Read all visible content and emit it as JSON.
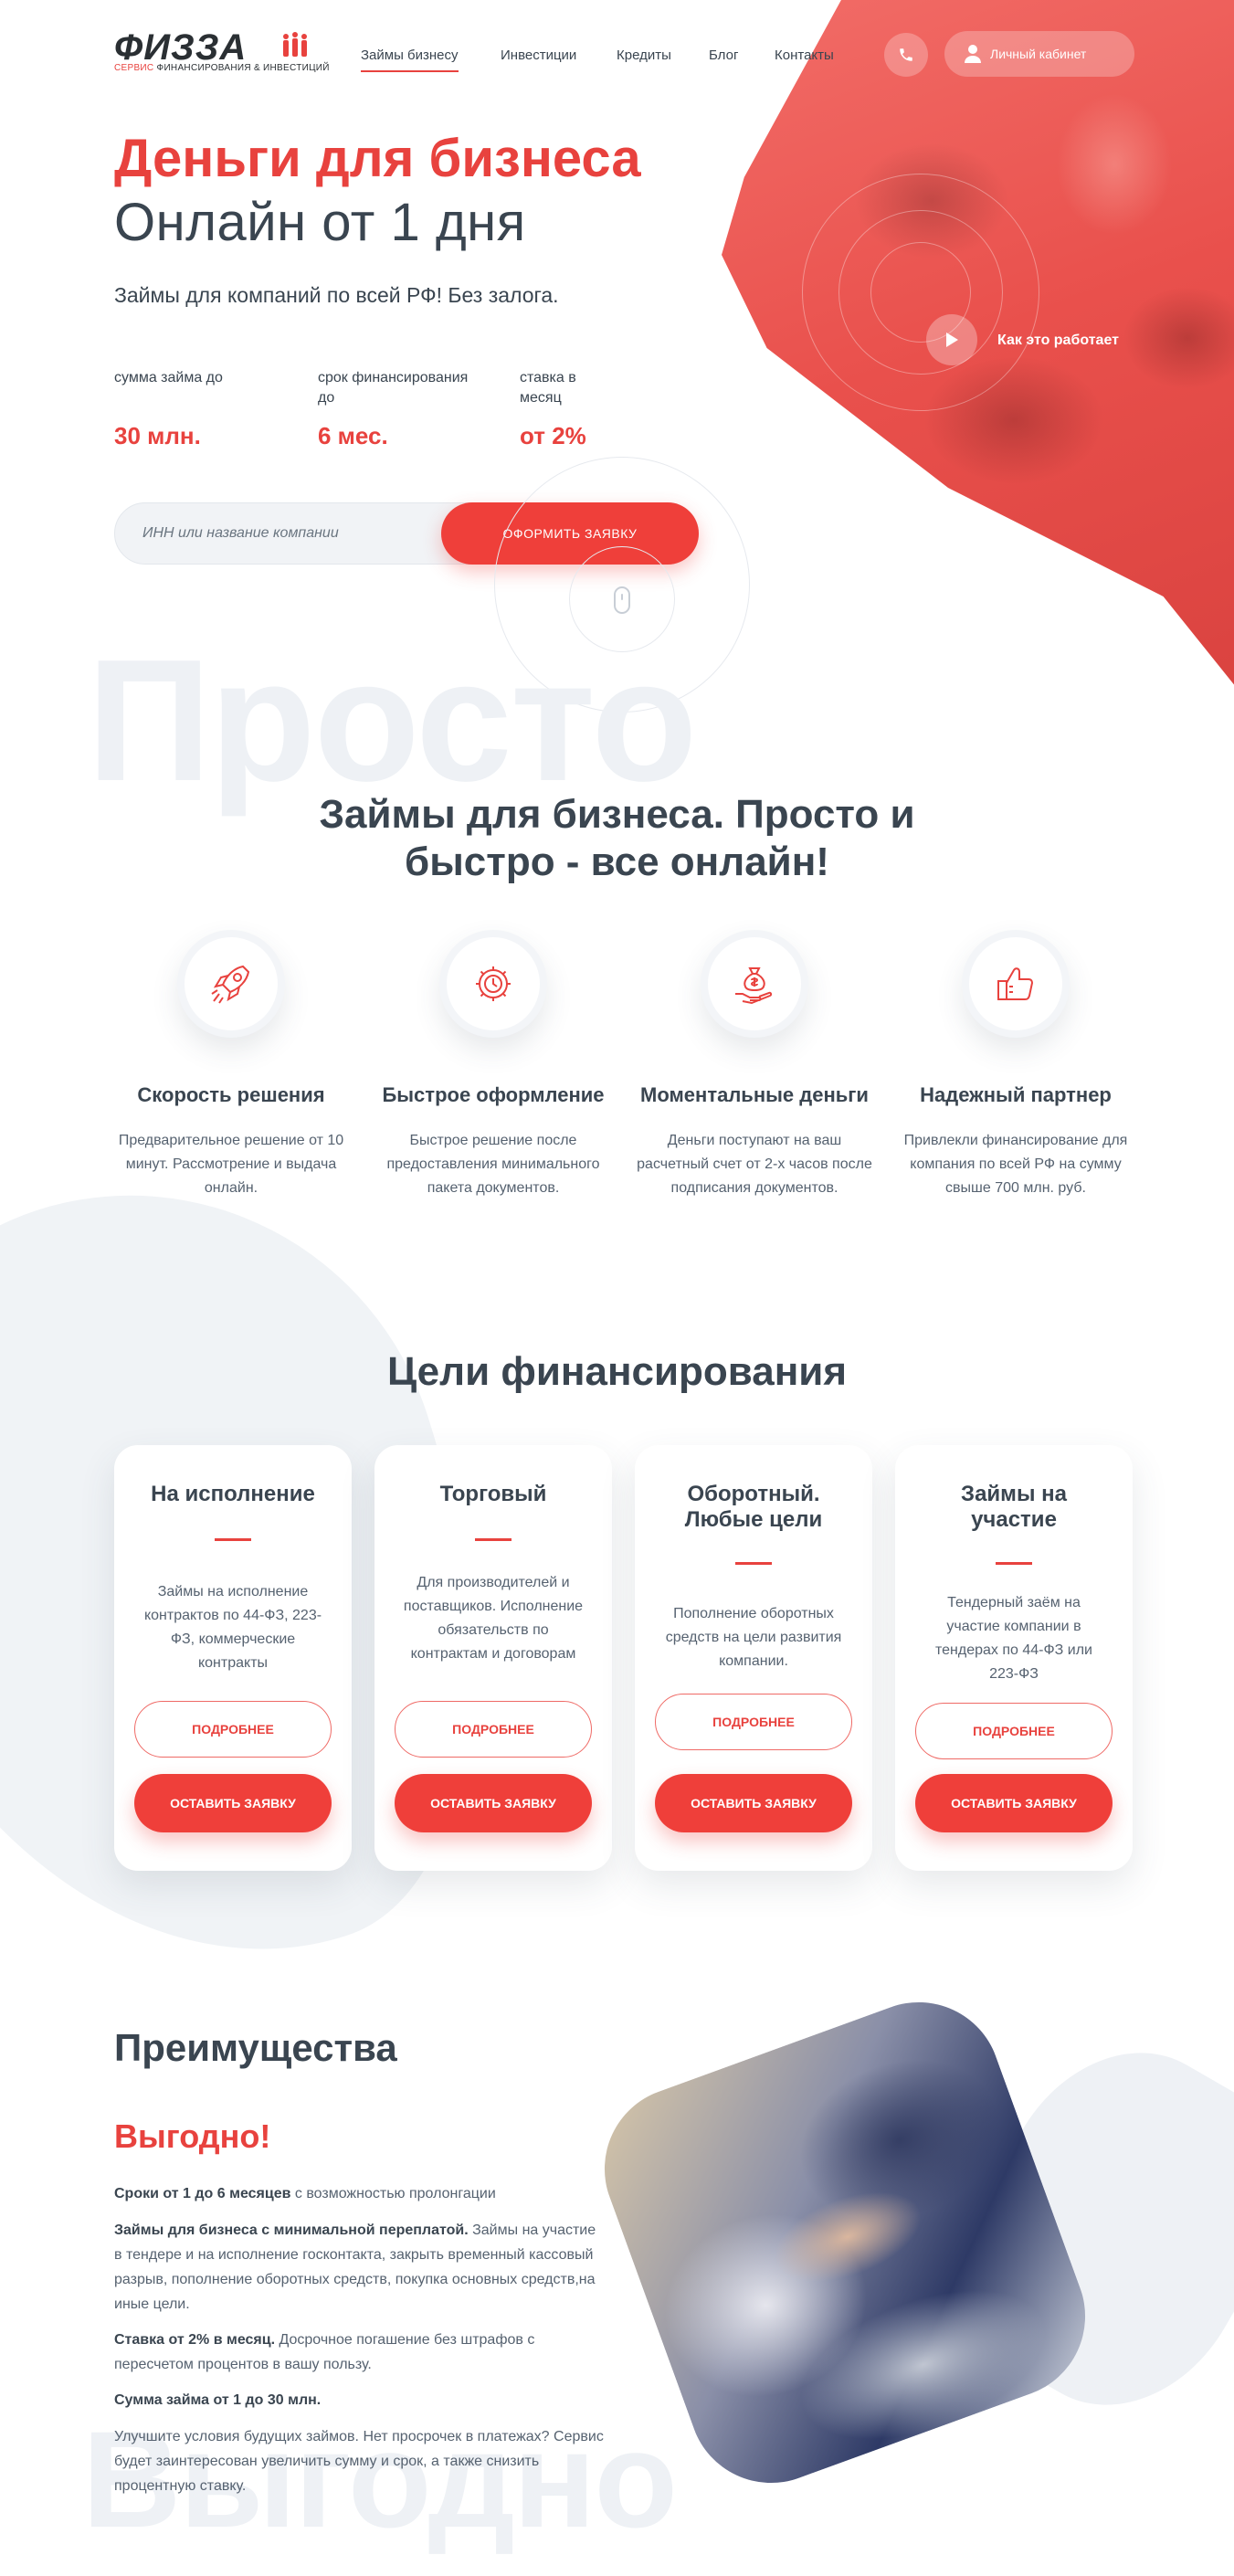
{
  "brand": {
    "logo": "ФИЗЗА",
    "tagline_red": "СЕРВИС",
    "tagline_rest": "ФИНАНСИРОВАНИЯ & ИНВЕСТИЦИЙ"
  },
  "nav": {
    "items": [
      "Займы бизнесу",
      "Инвестиции",
      "Кредиты",
      "Блог",
      "Контакты"
    ],
    "active": "Займы бизнесу"
  },
  "header": {
    "cabinet_label": "Личный кабинет",
    "phone_icon": "phone-icon",
    "user_icon": "user-icon"
  },
  "hero": {
    "title_red": "Деньги для бизнеса",
    "title_dark": "Онлайн от 1 дня",
    "subtitle": "Займы для компаний по всей РФ! Без залога.",
    "stats": [
      {
        "label": "сумма займа до",
        "value": "30 млн."
      },
      {
        "label": "срок финансирования до",
        "value": "6 мес."
      },
      {
        "label": "ставка в месяц",
        "value": "от 2%"
      }
    ],
    "input_placeholder": "ИНН или название компании",
    "submit_label": "ОФОРМИТЬ ЗАЯВКУ",
    "video_link": "Как это работает",
    "accent_color": "#ef3f3a"
  },
  "features": {
    "watermark": "Просто",
    "title_line1": "Займы для бизнеса. Просто и",
    "title_line2": "быстро - все онлайн!",
    "items": [
      {
        "icon": "rocket-icon",
        "title": "Скорость решения",
        "text": "Предварительное решение от 10 минут. Рассмотрение и выдача онлайн."
      },
      {
        "icon": "gear-clock-icon",
        "title": "Быстрое оформление",
        "text": "Быстрое решение после предоставления минимального пакета документов."
      },
      {
        "icon": "money-bag-hand-icon",
        "title": "Моментальные деньги",
        "text": "Деньги поступают на ваш расчетный счет от 2-х часов после подписания документов."
      },
      {
        "icon": "thumbs-up-icon",
        "title": "Надежный партнер",
        "text": "Привлекли финансирование для компания по всей РФ на сумму свыше 700 млн. руб."
      }
    ]
  },
  "goals": {
    "title": "Цели финансирования",
    "more_label": "ПОДРОБНЕЕ",
    "apply_label": "ОСТАВИТЬ ЗАЯВКУ",
    "cards": [
      {
        "title": "На исполнение",
        "text": "Займы на исполнение контрактов по 44-ФЗ, 223-ФЗ, коммерческие контракты"
      },
      {
        "title": "Торговый",
        "text": "Для производителей и поставщиков. Исполнение обязательств по контрактам и договорам"
      },
      {
        "title": "Оборотный. Любые цели",
        "text": "Пополнение оборотных средств на цели развития компании."
      },
      {
        "title": "Займы на участие",
        "text": "Тендерный заём на участие компании в тендерах по 44-ФЗ или 223-ФЗ"
      }
    ]
  },
  "advantages": {
    "title": "Преимущества",
    "subtitle": "Выгодно!",
    "watermark": "Выгодно",
    "p1_bold": "Сроки от 1 до 6 месяцев",
    "p1_rest": " с возможностью пролонгации",
    "p2_bold": "Займы для бизнеса с минимальной переплатой.",
    "p2_rest": " Займы на участие в тендере и на исполнение госконтакта, закрыть временный кассовый разрыв, пополнение оборотных средств, покупка основных средств,на иные цели.",
    "p3_bold": "Ставка от 2% в месяц.",
    "p3_rest": " Досрочное погашение без штрафов с пересчетом процентов в вашу пользу.",
    "p4_bold": "Сумма займа от 1 до 30 млн.",
    "p5": "Улучшите условия будущих займов. Нет просрочек в платежах? Сервис будет заинтересован увеличить сумму и срок, а также снизить процентную ставку."
  }
}
